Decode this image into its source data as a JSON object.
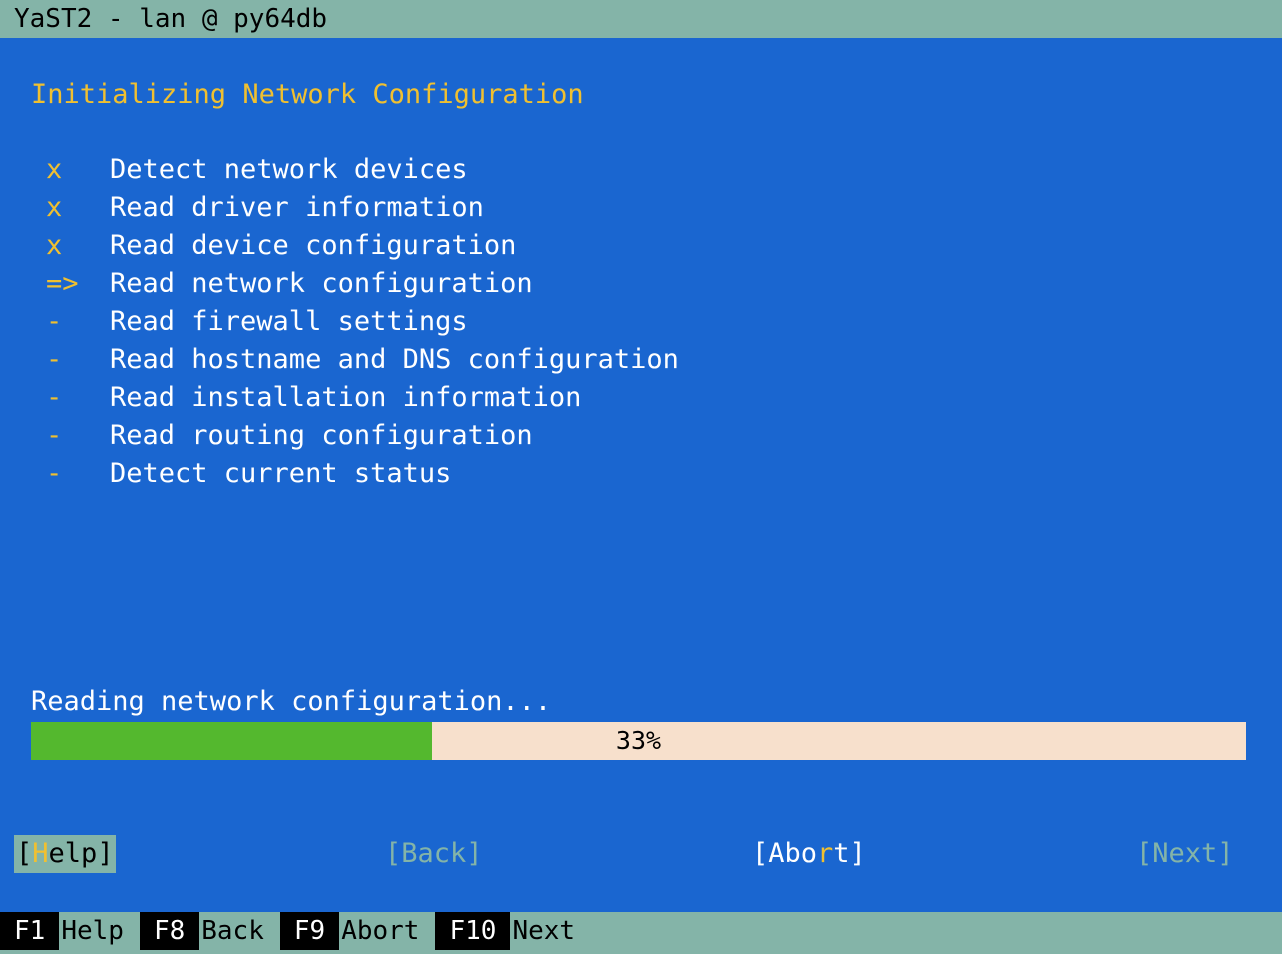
{
  "window": {
    "title": "YaST2 - lan @ py64db"
  },
  "heading": "Initializing Network Configuration",
  "steps": [
    {
      "mark": "x",
      "label": "Detect network devices",
      "state": "done"
    },
    {
      "mark": "x",
      "label": "Read driver information",
      "state": "done"
    },
    {
      "mark": "x",
      "label": "Read device configuration",
      "state": "done"
    },
    {
      "mark": "=>",
      "label": "Read network configuration",
      "state": "current"
    },
    {
      "mark": "-",
      "label": "Read firewall settings",
      "state": "pending"
    },
    {
      "mark": "-",
      "label": "Read hostname and DNS configuration",
      "state": "pending"
    },
    {
      "mark": "-",
      "label": "Read installation information",
      "state": "pending"
    },
    {
      "mark": "-",
      "label": "Read routing configuration",
      "state": "pending"
    },
    {
      "mark": "-",
      "label": "Detect current status",
      "state": "pending"
    }
  ],
  "status": {
    "text": "Reading network configuration...",
    "progress_percent": 33,
    "progress_label": "33%"
  },
  "buttons": {
    "help": {
      "open": "[",
      "hotkey": "H",
      "rest": "elp",
      "close": "]"
    },
    "back": {
      "label": "[Back]"
    },
    "abort": {
      "pre": "[Abo",
      "hotkey": "r",
      "post": "t]"
    },
    "next": {
      "label": "[Next]"
    }
  },
  "footer": {
    "keys": [
      {
        "key": "F1",
        "label": "Help"
      },
      {
        "key": "F8",
        "label": "Back"
      },
      {
        "key": "F9",
        "label": "Abort"
      },
      {
        "key": "F10",
        "label": "Next"
      }
    ]
  },
  "colors": {
    "background": "#1a66d0",
    "accent": "#f0c030",
    "bar": "#84b4a8",
    "progress_fill": "#54b82e",
    "progress_track": "#f7e0cc"
  }
}
